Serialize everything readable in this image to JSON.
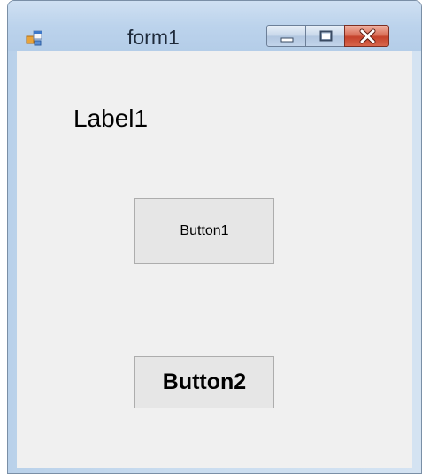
{
  "window": {
    "title": "form1",
    "icon": "form-app-icon",
    "controls": {
      "minimize": "minimize-icon",
      "maximize": "maximize-icon",
      "close": "close-icon"
    }
  },
  "form": {
    "label1_text": "Label1",
    "button1_label": "Button1",
    "button2_label": "Button2"
  },
  "colors": {
    "client_background": "#f0f0f0",
    "title_bar": "#bcd3ec",
    "close_button": "#c4422b"
  }
}
